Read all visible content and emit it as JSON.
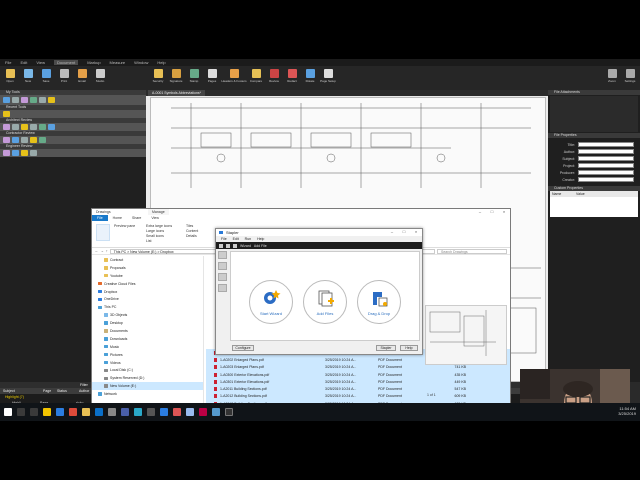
{
  "menu": [
    "File",
    "Edit",
    "View",
    "Document",
    "Markup",
    "Measure",
    "Window",
    "Help"
  ],
  "menu_active": "Document",
  "ribbon": [
    "Open",
    "New",
    "Save",
    "Print",
    "Email",
    "Studio",
    "Security",
    "Signature",
    "Stamp",
    "Pages",
    "Headers & Footers",
    "Compare",
    "Review",
    "Redact",
    "Rotate",
    "Page Setup"
  ],
  "ribbon_right": [
    "Zoom",
    "Settings"
  ],
  "left_panels": [
    "My Tools",
    "Recent Tools",
    "Architect Review",
    "Contractor Review",
    "Engineer Review"
  ],
  "doc_tab": "A-0001 Symbols Abbreviations*",
  "right_panel": {
    "file_attachments": "File Attachments",
    "file_properties": "File Properties",
    "fields": [
      "Title:",
      "Author:",
      "Subject:",
      "Project:",
      "Producer:",
      "Creator:"
    ],
    "custom_properties": "Custom Properties",
    "custom_cols": [
      "Name",
      "Value"
    ]
  },
  "markups": {
    "filter": "Filter",
    "columns": [
      "Subject",
      "Page",
      "Status",
      "Author",
      "Date"
    ],
    "group": "Highlight (7)",
    "rows": [
      {
        "subject": "Highli...",
        "page": "Page...",
        "author": "ricko",
        "date": "3/25/1",
        "label": "",
        "qty": ""
      },
      {
        "subject": "Highli...",
        "page": "Page...",
        "author": "ricko",
        "date": "3/25/1",
        "label": "",
        "qty": ""
      },
      {
        "subject": "Highli...",
        "page": "Page...",
        "author": "ricko",
        "date": "3/25/1",
        "label": "Framing Plate",
        "qty": "1"
      },
      {
        "subject": "Highli...",
        "page": "Page...",
        "author": "ricko",
        "date": "3/25/1",
        "label": "",
        "qty": "1"
      },
      {
        "subject": "Highli...",
        "page": "Page...",
        "author": "ricko",
        "date": "3/25/1",
        "label": "Framing Plate",
        "qty": "1"
      },
      {
        "subject": "Highli...",
        "page": "Page...",
        "author": "ricko",
        "date": "3/25/1",
        "label": "Framing Plate",
        "qty": "1"
      }
    ]
  },
  "explorer": {
    "title": "Drawings",
    "tab_manage": "Manage",
    "tabs": [
      "File",
      "Home",
      "Share",
      "View"
    ],
    "ribbon_items": [
      "Preview pane",
      "Extra large icons",
      "Large icons",
      "Small icons",
      "List",
      "Tiles",
      "Content",
      "Details"
    ],
    "address": "This PC  >  New Volume (E:)  >  Dropbox",
    "search": "Search Drawings",
    "nav": [
      {
        "label": "Contract",
        "color": "#e8c055"
      },
      {
        "label": "Proposals",
        "color": "#e8c055"
      },
      {
        "label": "Youtube",
        "color": "#e8c055"
      },
      {
        "label": "Creative Cloud Files",
        "color": "#e56a2a"
      },
      {
        "label": "Dropbox",
        "color": "#2b7de1"
      },
      {
        "label": "OneDrive",
        "color": "#2b7de1"
      },
      {
        "label": "This PC",
        "color": "#4aa0d8"
      },
      {
        "label": "3D Objects",
        "color": "#7ab8e8"
      },
      {
        "label": "Desktop",
        "color": "#4aa0d8"
      },
      {
        "label": "Documents",
        "color": "#c9b178"
      },
      {
        "label": "Downloads",
        "color": "#4aa0d8"
      },
      {
        "label": "Music",
        "color": "#4aa0d8"
      },
      {
        "label": "Pictures",
        "color": "#4aa0d8"
      },
      {
        "label": "Videos",
        "color": "#4aa0d8"
      },
      {
        "label": "Local Disk (C:)",
        "color": "#888"
      },
      {
        "label": "System Reserved (D:)",
        "color": "#888"
      },
      {
        "label": "New Volume (E:)",
        "color": "#888"
      },
      {
        "label": "Network",
        "color": "#4aa0d8"
      }
    ],
    "files": [
      {
        "name": "1-A0201 Enlarged Plans.pdf",
        "date": "3/25/2019 10:24 A...",
        "type": "PDF Document",
        "size": "294 KB"
      },
      {
        "name": "1-A0202 Enlarged Plans.pdf",
        "date": "3/25/2019 10:24 A...",
        "type": "PDF Document",
        "size": "336 KB"
      },
      {
        "name": "1-A0203 Enlarged Plans.pdf",
        "date": "3/25/2019 10:24 A...",
        "type": "PDF Document",
        "size": "741 KB"
      },
      {
        "name": "1-A0300 Exterior Elevations.pdf",
        "date": "3/25/2019 10:24 A...",
        "type": "PDF Document",
        "size": "435 KB"
      },
      {
        "name": "1-A0301 Exterior Elevations.pdf",
        "date": "3/25/2019 10:24 A...",
        "type": "PDF Document",
        "size": "449 KB"
      },
      {
        "name": "1-A2011 Building Sections.pdf",
        "date": "3/25/2019 10:24 A...",
        "type": "PDF Document",
        "size": "547 KB"
      },
      {
        "name": "1-A2012 Building Sections.pdf",
        "date": "3/25/2019 10:24 A...",
        "type": "PDF Document",
        "size": "609 KB"
      },
      {
        "name": "1-A2013 Building Sections.pdf",
        "date": "3/25/2019 10:24 A...",
        "type": "PDF Document",
        "size": "628 KB"
      }
    ],
    "status_items": "451 items",
    "status_selected": "6 items selected  10.7 MB"
  },
  "stapler": {
    "title": "Stapler",
    "menu": [
      "File",
      "Edit",
      "Run",
      "Help"
    ],
    "toolbar": [
      "Wizard",
      "Add File"
    ],
    "wizards": [
      "Start Wizard",
      "Add Files",
      "Drag & Drop"
    ],
    "buttons": {
      "configure": "Configure",
      "stapler": "Stapler",
      "help": "Help"
    }
  },
  "page_indicator": "1 of 1",
  "tray": {
    "time": "11:54 AM",
    "date": "3/25/2019"
  }
}
